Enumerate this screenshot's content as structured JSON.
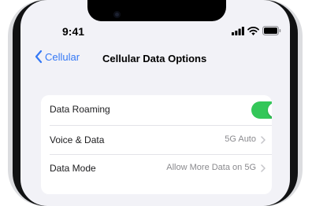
{
  "status_bar": {
    "time": "9:41",
    "icons": [
      "signal-icon",
      "wifi-icon",
      "battery-icon"
    ]
  },
  "nav": {
    "back_label": "Cellular",
    "title": "Cellular Data Options"
  },
  "settings": {
    "rows": [
      {
        "label": "Data Roaming",
        "control": "toggle",
        "on": true
      },
      {
        "label": "Voice & Data",
        "value": "5G Auto"
      },
      {
        "label": "Data Mode",
        "value": "Allow More Data on 5G"
      }
    ]
  },
  "colors": {
    "accent": "#3478f6",
    "toggle_on": "#34c759",
    "background": "#f2f2f7",
    "secondary_text": "#8a8a8e"
  }
}
